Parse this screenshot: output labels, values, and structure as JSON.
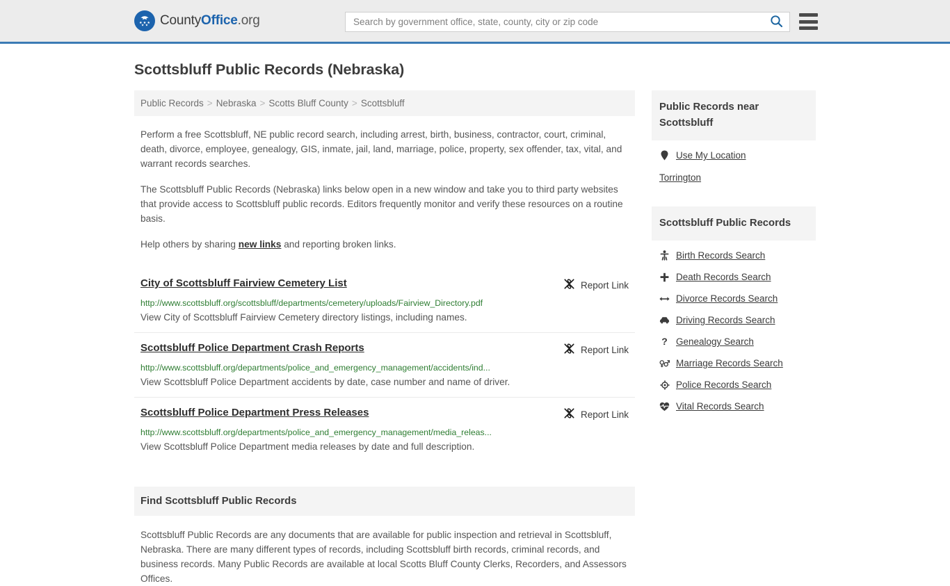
{
  "header": {
    "logo": {
      "part1": "County",
      "part2": "Office",
      "part3": ".org",
      "icon": "eagle-shield-logo"
    },
    "search": {
      "placeholder": "Search by government office, state, county, city or zip code",
      "value": "",
      "icon": "search-icon"
    },
    "menu_icon": "hamburger-menu-icon",
    "accent_color": "#3b7bb5",
    "background_color": "#ececec"
  },
  "page": {
    "title": "Scottsbluff Public Records (Nebraska)"
  },
  "breadcrumb": {
    "separator": ">",
    "items": [
      {
        "label": "Public Records"
      },
      {
        "label": "Nebraska"
      },
      {
        "label": "Scotts Bluff County"
      },
      {
        "label": "Scottsbluff"
      }
    ]
  },
  "intro": {
    "paragraph_1": "Perform a free Scottsbluff, NE public record search, including arrest, birth, business, contractor, court, criminal, death, divorce, employee, genealogy, GIS, inmate, jail, land, marriage, police, property, sex offender, tax, vital, and warrant records searches.",
    "paragraph_2": "The Scottsbluff Public Records (Nebraska) links below open in a new window and take you to third party websites that provide access to Scottsbluff public records. Editors frequently monitor and verify these resources on a routine basis.",
    "paragraph_3_before": "Help others by sharing ",
    "paragraph_3_link": "new links",
    "paragraph_3_after": " and reporting broken links."
  },
  "results": {
    "report_label": "Report Link",
    "report_icon": "broken-link-icon",
    "items": [
      {
        "title": "City of Scottsbluff Fairview Cemetery List",
        "url": "http://www.scottsbluff.org/scottsbluff/departments/cemetery/uploads/Fairview_Directory.pdf",
        "description": "View City of Scottsbluff Fairview Cemetery directory listings, including names."
      },
      {
        "title": "Scottsbluff Police Department Crash Reports",
        "url": "http://www.scottsbluff.org/departments/police_and_emergency_management/accidents/ind...",
        "description": "View Scottsbluff Police Department accidents by date, case number and name of driver."
      },
      {
        "title": "Scottsbluff Police Department Press Releases",
        "url": "http://www.scottsbluff.org/departments/police_and_emergency_management/media_releas...",
        "description": "View Scottsbluff Police Department media releases by date and full description."
      }
    ]
  },
  "find_section": {
    "heading": "Find Scottsbluff Public Records",
    "body": "Scottsbluff Public Records are any documents that are available for public inspection and retrieval in Scottsbluff, Nebraska. There are many different types of records, including Scottsbluff birth records, criminal records, and business records. Many Public Records are available at local Scotts Bluff County Clerks, Recorders, and Assessors Offices."
  },
  "sidebar": {
    "near_heading": "Public Records near Scottsbluff",
    "use_my_location": {
      "label": "Use My Location",
      "icon": "map-pin-icon"
    },
    "nearby_places": [
      {
        "label": "Torrington"
      }
    ],
    "records_heading": "Scottsbluff Public Records",
    "record_links": [
      {
        "label": "Birth Records Search",
        "icon": "baby-icon"
      },
      {
        "label": "Death Records Search",
        "icon": "cross-icon"
      },
      {
        "label": "Divorce Records Search",
        "icon": "arrows-left-right-icon"
      },
      {
        "label": "Driving Records Search",
        "icon": "car-icon"
      },
      {
        "label": "Genealogy Search",
        "icon": "question-mark-icon"
      },
      {
        "label": "Marriage Records Search",
        "icon": "venus-mars-icon"
      },
      {
        "label": "Police Records Search",
        "icon": "police-badge-icon"
      },
      {
        "label": "Vital Records Search",
        "icon": "heartbeat-icon"
      }
    ]
  },
  "colors": {
    "link_green": "#2e7d32",
    "panel_gray": "#f4f4f4",
    "text_gray": "#555555"
  }
}
